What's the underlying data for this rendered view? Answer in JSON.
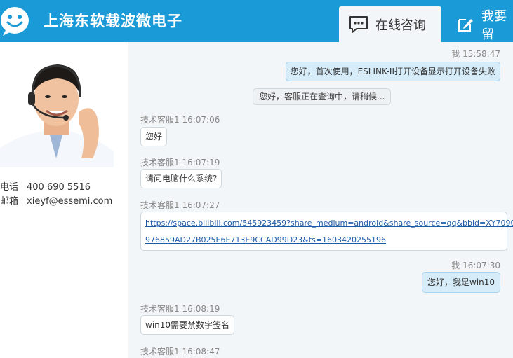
{
  "header": {
    "brand": "上海东软载波微电子",
    "tabs": [
      {
        "label": "在线咨询",
        "icon": "chat-icon",
        "active": true
      },
      {
        "label": "我要留",
        "icon": "edit-icon",
        "active": false
      }
    ],
    "color": "#1a9ad6"
  },
  "sidebar": {
    "phone_label": "电话",
    "phone": "400 690 5516",
    "email_label": "邮箱",
    "email": "xieyf@essemi.com"
  },
  "messages": [
    {
      "sender": "我",
      "time": "15:58:47",
      "text": "您好，首次使用，ESLINK-II打开设备显示打开设备失败",
      "side": "right"
    },
    {
      "text": "您好，客服正在查询中，请稍候...",
      "side": "system"
    },
    {
      "sender": "技术客服1",
      "time": "16:07:06",
      "text": "您好",
      "side": "left"
    },
    {
      "sender": "技术客服1",
      "time": "16:07:19",
      "text": "请问电脑什么系统?",
      "side": "left"
    },
    {
      "sender": "技术客服1",
      "time": "16:07:27",
      "link_line1": "https://space.bilibili.com/545923459?share_medium=android&share_source=qq&bbid=XY7090",
      "link_line2": "976859AD27B025E6E713E9CCAD99D23&ts=1603420255196",
      "side": "left"
    },
    {
      "sender": "我",
      "time": "16:07:30",
      "text": "您好，我是win10",
      "side": "right"
    },
    {
      "sender": "技术客服1",
      "time": "16:08:19",
      "text": "win10需要禁数字签名",
      "side": "left"
    },
    {
      "sender": "技术客服1",
      "time": "16:08:47",
      "side": "left"
    }
  ]
}
